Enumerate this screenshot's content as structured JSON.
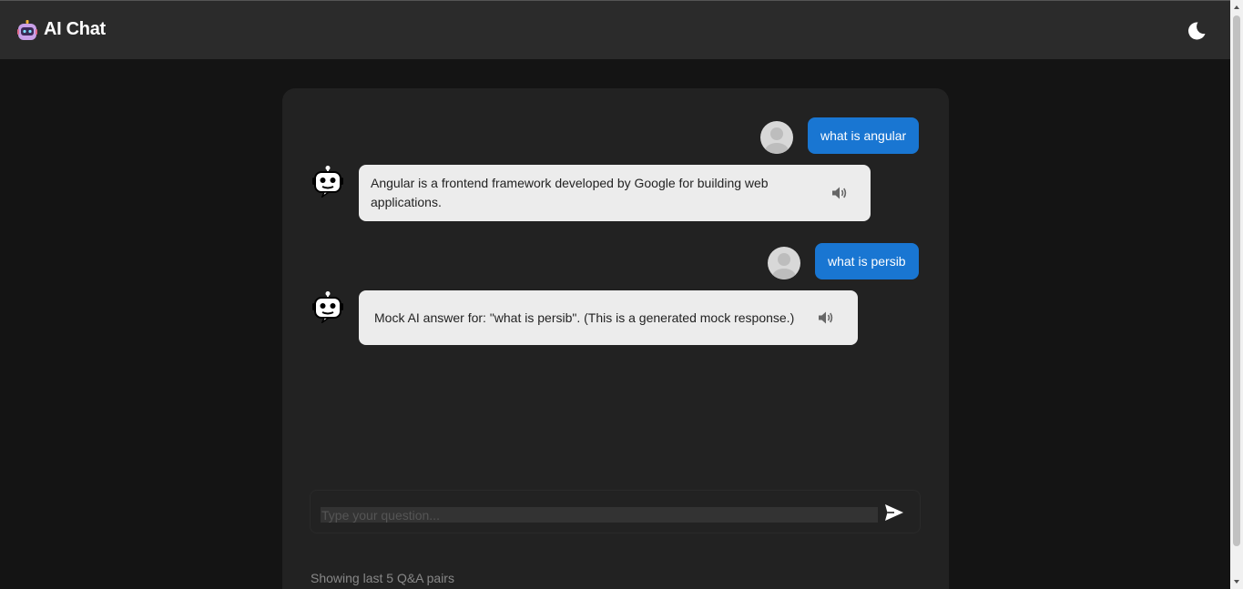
{
  "header": {
    "title": "AI Chat",
    "logo_icon": "robot-logo-icon",
    "theme_icon": "moon-icon"
  },
  "messages": [
    {
      "role": "user",
      "text": "what is angular"
    },
    {
      "role": "bot",
      "text": "Angular is a frontend framework developed by Google for building web applications."
    },
    {
      "role": "user",
      "text": "what is persib"
    },
    {
      "role": "bot",
      "text": "Mock AI answer for: \"what is persib\". (This is a generated mock response.)"
    }
  ],
  "composer": {
    "placeholder": "Type your question...",
    "value": "",
    "send_icon": "send-icon"
  },
  "footer": {
    "note": "Showing last 5 Q&A pairs"
  },
  "colors": {
    "accent": "#1976d2",
    "background": "#141414",
    "card": "#222222",
    "header": "#2b2b2b",
    "bot_bubble": "#ececec"
  }
}
